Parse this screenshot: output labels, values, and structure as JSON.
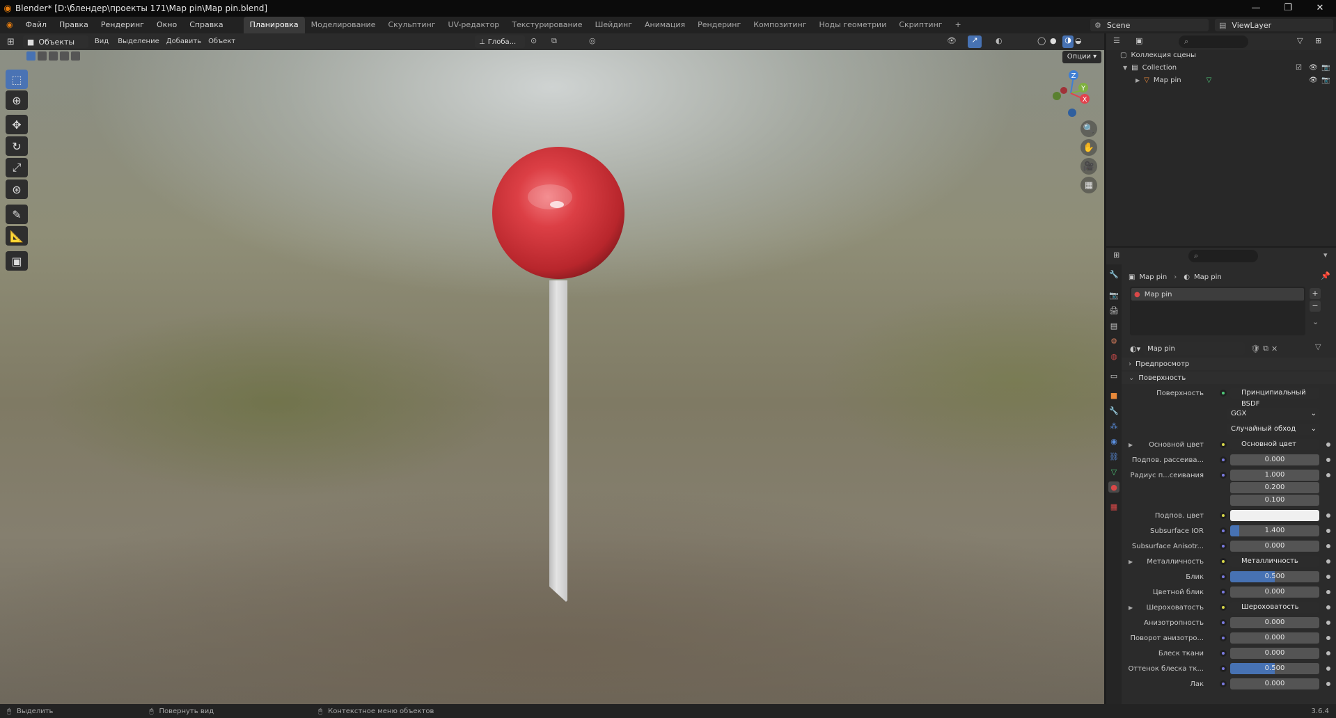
{
  "window": {
    "title": "Blender* [D:\\блендер\\проекты 171\\Map pin\\Map pin.blend]",
    "min": "—",
    "max": "❐",
    "close": "✕"
  },
  "menu": [
    "Файл",
    "Правка",
    "Рендеринг",
    "Окно",
    "Справка"
  ],
  "workspaces": [
    "Планировка",
    "Моделирование",
    "Скульптинг",
    "UV-редактор",
    "Текстурирование",
    "Шейдинг",
    "Анимация",
    "Рендеринг",
    "Композитинг",
    "Ноды геометрии",
    "Скриптинг"
  ],
  "workspace_add": "+",
  "scene_name": "Scene",
  "view_layer": "ViewLayer",
  "viewport_header": {
    "mode": "Объекты",
    "menus": [
      "Вид",
      "Выделение",
      "Добавить",
      "Объект"
    ],
    "orientation": "Глоба...",
    "options": "Опции"
  },
  "gizmo": {
    "z": "Z",
    "y": "Y",
    "x": "X"
  },
  "outliner": {
    "scene_collection": "Коллекция сцены",
    "collection": "Collection",
    "object": "Map pin"
  },
  "properties": {
    "breadcrumb_object": "Map pin",
    "breadcrumb_material": "Map pin",
    "slot_name": "Map pin",
    "material_name": "Map pin",
    "sections": {
      "preview": "Предпросмотр",
      "surface": "Поверхность"
    },
    "surface_label": "Поверхность",
    "surface_value": "Принципиальный BSDF",
    "distribution": "GGX",
    "subsurface_method": "Случайный обход",
    "rows": [
      {
        "label": "Основной цвет",
        "value": "Основной цвет",
        "kind": "link"
      },
      {
        "label": "Подпов. рассеива...",
        "value": "0.000",
        "kind": "num"
      },
      {
        "label": "Радиус п...сеивания",
        "value": "1.000",
        "kind": "num"
      },
      {
        "label": "",
        "value": "0.200",
        "kind": "num"
      },
      {
        "label": "",
        "value": "0.100",
        "kind": "num"
      },
      {
        "label": "Подпов. цвет",
        "value": "",
        "kind": "color"
      },
      {
        "label": "Subsurface IOR",
        "value": "1.400",
        "kind": "bar",
        "fill": 0.1
      },
      {
        "label": "Subsurface Anisotr...",
        "value": "0.000",
        "kind": "num"
      },
      {
        "label": "Металличность",
        "value": "Металличность",
        "kind": "link"
      },
      {
        "label": "Блик",
        "value": "0.500",
        "kind": "bar",
        "fill": 0.5
      },
      {
        "label": "Цветной блик",
        "value": "0.000",
        "kind": "num"
      },
      {
        "label": "Шероховатость",
        "value": "Шероховатость",
        "kind": "link"
      },
      {
        "label": "Анизотропность",
        "value": "0.000",
        "kind": "num"
      },
      {
        "label": "Поворот анизотро...",
        "value": "0.000",
        "kind": "num"
      },
      {
        "label": "Блеск ткани",
        "value": "0.000",
        "kind": "num"
      },
      {
        "label": "Оттенок блеска тк...",
        "value": "0.500",
        "kind": "bar",
        "fill": 0.5
      },
      {
        "label": "Лак",
        "value": "0.000",
        "kind": "num"
      }
    ]
  },
  "statusbar": {
    "select": "Выделить",
    "rotate": "Повернуть вид",
    "context": "Контекстное меню объектов",
    "version": "3.6.4"
  },
  "colors": {
    "accent": "#4772b3",
    "pin_head": "#d9393e",
    "pin_needle": "#d7d7d7"
  }
}
